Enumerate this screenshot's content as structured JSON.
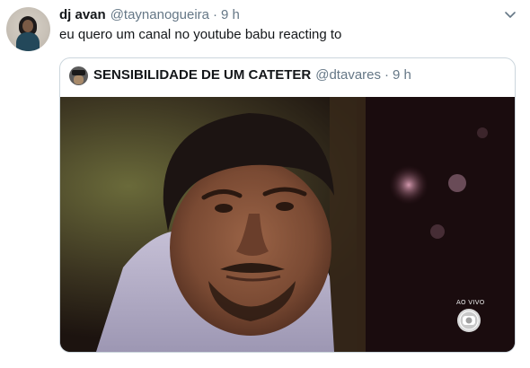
{
  "tweet": {
    "author_name": "dj avan",
    "author_handle": "@taynanogueira",
    "separator": "·",
    "time": "9 h",
    "text": "eu quero um canal no youtube babu reacting to"
  },
  "quoted_tweet": {
    "author_name": "SENSIBILIDADE DE UM CATETER",
    "author_handle": "@dtavares",
    "separator": "·",
    "time": "9 h",
    "media": {
      "live_label": "AO VIVO",
      "logo_icon": "globo-logo-icon"
    }
  },
  "colors": {
    "secondary_text": "#657786",
    "border": "#ccd6dd"
  },
  "icons": {
    "menu": "chevron-down-icon"
  }
}
